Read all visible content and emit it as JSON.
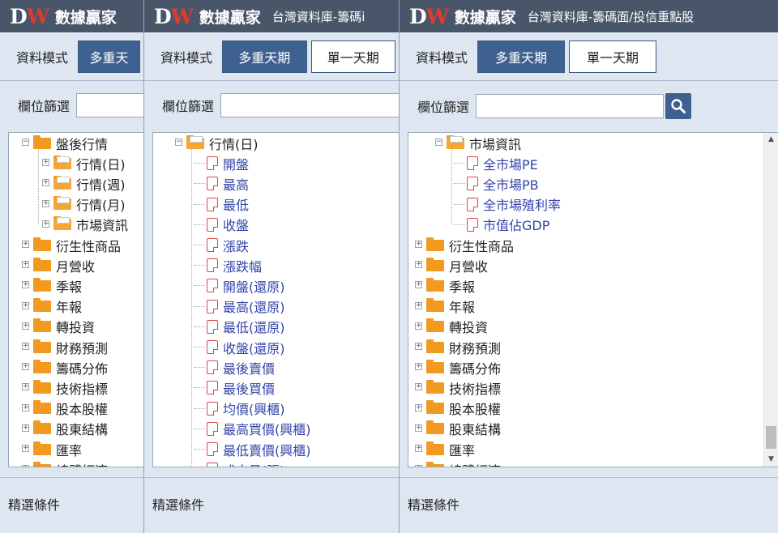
{
  "app": {
    "logo": "DW",
    "brand": "數據贏家",
    "subtitle": "台灣資料庫-籌碼面/投信重點股",
    "subtitle_truncated": "台灣資料庫-籌碼i"
  },
  "mode": {
    "label": "資料模式",
    "buttons": [
      "多重天期",
      "單一天期"
    ],
    "button_truncated": "多重天"
  },
  "filter": {
    "label": "欄位篩選",
    "value": "",
    "placeholder": ""
  },
  "footer": {
    "label": "精選條件"
  },
  "icons": {
    "search": "search-icon",
    "folder": "folder-icon",
    "doc": "document-icon"
  },
  "colors": {
    "titlebar": "#495669",
    "accent": "#3f618f",
    "leaf_text": "#3344aa",
    "logo_w": "#e03a2b"
  },
  "panel1": {
    "tree": [
      {
        "label": "盤後行情",
        "type": "folder",
        "level": 0,
        "expanded": true
      },
      {
        "label": "行情(日)",
        "type": "folder",
        "level": 1,
        "expanded": false
      },
      {
        "label": "行情(週)",
        "type": "folder",
        "level": 1,
        "expanded": false
      },
      {
        "label": "行情(月)",
        "type": "folder",
        "level": 1,
        "expanded": false
      },
      {
        "label": "市場資訊",
        "type": "folder",
        "level": 1,
        "expanded": false
      },
      {
        "label": "衍生性商品",
        "type": "folder",
        "level": 0,
        "expanded": false
      },
      {
        "label": "月營收",
        "type": "folder",
        "level": 0,
        "expanded": false
      },
      {
        "label": "季報",
        "type": "folder",
        "level": 0,
        "expanded": false
      },
      {
        "label": "年報",
        "type": "folder",
        "level": 0,
        "expanded": false
      },
      {
        "label": "轉投資",
        "type": "folder",
        "level": 0,
        "expanded": false
      },
      {
        "label": "財務預測",
        "type": "folder",
        "level": 0,
        "expanded": false
      },
      {
        "label": "籌碼分佈",
        "type": "folder",
        "level": 0,
        "expanded": false
      },
      {
        "label": "技術指標",
        "type": "folder",
        "level": 0,
        "expanded": false
      },
      {
        "label": "股本股權",
        "type": "folder",
        "level": 0,
        "expanded": false
      },
      {
        "label": "股東結構",
        "type": "folder",
        "level": 0,
        "expanded": false
      },
      {
        "label": "匯率",
        "type": "folder",
        "level": 0,
        "expanded": false
      },
      {
        "label": "總體經濟",
        "type": "folder",
        "level": 0,
        "expanded": false
      }
    ]
  },
  "panel2": {
    "tree": [
      {
        "label": "行情(日)",
        "type": "folder",
        "level": 1,
        "expanded": true
      },
      {
        "label": "開盤",
        "type": "leaf",
        "level": 2
      },
      {
        "label": "最高",
        "type": "leaf",
        "level": 2
      },
      {
        "label": "最低",
        "type": "leaf",
        "level": 2
      },
      {
        "label": "收盤",
        "type": "leaf",
        "level": 2
      },
      {
        "label": "漲跌",
        "type": "leaf",
        "level": 2
      },
      {
        "label": "漲跌幅",
        "type": "leaf",
        "level": 2
      },
      {
        "label": "開盤(還原)",
        "type": "leaf",
        "level": 2
      },
      {
        "label": "最高(還原)",
        "type": "leaf",
        "level": 2
      },
      {
        "label": "最低(還原)",
        "type": "leaf",
        "level": 2
      },
      {
        "label": "收盤(還原)",
        "type": "leaf",
        "level": 2
      },
      {
        "label": "最後賣價",
        "type": "leaf",
        "level": 2
      },
      {
        "label": "最後買價",
        "type": "leaf",
        "level": 2
      },
      {
        "label": "均價(興櫃)",
        "type": "leaf",
        "level": 2
      },
      {
        "label": "最高買價(興櫃)",
        "type": "leaf",
        "level": 2
      },
      {
        "label": "最低賣價(興櫃)",
        "type": "leaf",
        "level": 2
      },
      {
        "label": "成交量(張)",
        "type": "leaf",
        "level": 2
      }
    ]
  },
  "panel3": {
    "tree": [
      {
        "label": "市場資訊",
        "type": "folder",
        "level": 1,
        "expanded": true
      },
      {
        "label": "全市場PE",
        "type": "leaf",
        "level": 2
      },
      {
        "label": "全市場PB",
        "type": "leaf",
        "level": 2
      },
      {
        "label": "全市場殖利率",
        "type": "leaf",
        "level": 2
      },
      {
        "label": "市值佔GDP",
        "type": "leaf",
        "level": 2
      },
      {
        "label": "衍生性商品",
        "type": "folder",
        "level": 0,
        "expanded": false
      },
      {
        "label": "月營收",
        "type": "folder",
        "level": 0,
        "expanded": false
      },
      {
        "label": "季報",
        "type": "folder",
        "level": 0,
        "expanded": false
      },
      {
        "label": "年報",
        "type": "folder",
        "level": 0,
        "expanded": false
      },
      {
        "label": "轉投資",
        "type": "folder",
        "level": 0,
        "expanded": false
      },
      {
        "label": "財務預測",
        "type": "folder",
        "level": 0,
        "expanded": false
      },
      {
        "label": "籌碼分佈",
        "type": "folder",
        "level": 0,
        "expanded": false
      },
      {
        "label": "技術指標",
        "type": "folder",
        "level": 0,
        "expanded": false
      },
      {
        "label": "股本股權",
        "type": "folder",
        "level": 0,
        "expanded": false
      },
      {
        "label": "股東結構",
        "type": "folder",
        "level": 0,
        "expanded": false
      },
      {
        "label": "匯率",
        "type": "folder",
        "level": 0,
        "expanded": false
      },
      {
        "label": "總體經濟",
        "type": "folder",
        "level": 0,
        "expanded": false
      }
    ],
    "scrollbar": {
      "position": 0.9
    }
  }
}
